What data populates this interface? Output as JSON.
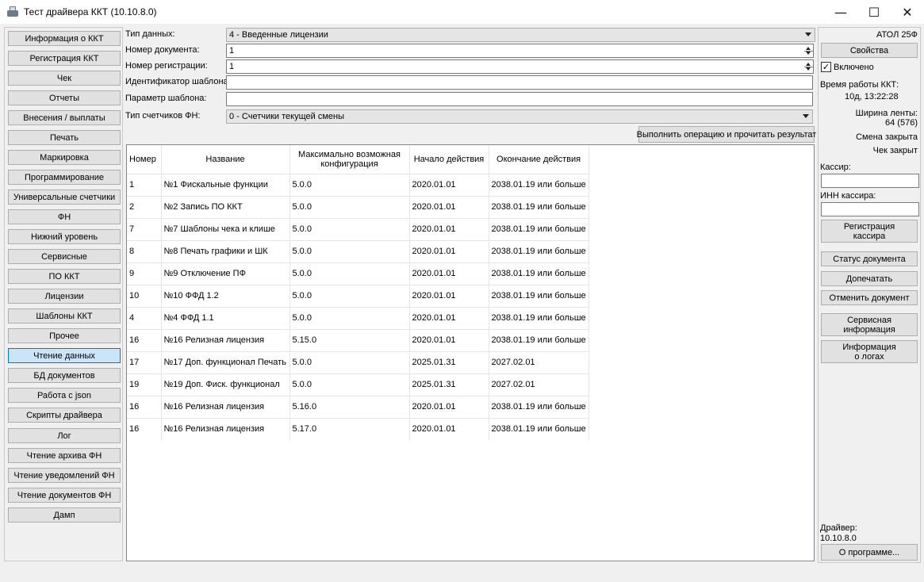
{
  "window": {
    "title": "Тест драйвера ККТ (10.10.8.0)",
    "min_glyph": "—",
    "max_glyph": "☐",
    "close_glyph": "✕"
  },
  "nav": [
    "Информация о ККТ",
    "Регистрация ККТ",
    "Чек",
    "Отчеты",
    "Внесения / выплаты",
    "Печать",
    "Маркировка",
    "Программирование",
    "Универсальные счетчики",
    "ФН",
    "Нижний уровень",
    "Сервисные",
    "ПО ККТ",
    "Лицензии",
    "Шаблоны ККТ",
    "Прочее",
    "Чтение данных",
    "БД документов",
    "Работа с json",
    "Скрипты драйвера",
    "Лог",
    "Чтение архива ФН",
    "Чтение уведомлений ФН",
    "Чтение документов ФН",
    "Дамп"
  ],
  "form": {
    "data_type_label": "Тип данных:",
    "data_type_value": "4 - Введенные лицензии",
    "doc_number_label": "Номер документа:",
    "doc_number_value": "1",
    "reg_number_label": "Номер регистрации:",
    "reg_number_value": "1",
    "template_id_label": "Идентификатор шаблона:",
    "template_id_value": "",
    "template_param_label": "Параметр шаблона:",
    "template_param_value": "",
    "fn_counter_label": "Тип счетчиков ФН:",
    "fn_counter_value": "0 - Счетчики текущей смены",
    "execute_label": "Выполнить операцию и прочитать результат"
  },
  "table": {
    "headers": [
      "Номер",
      "Название",
      "Максимально возможная конфигурация",
      "Начало действия",
      "Окончание действия"
    ],
    "rows": [
      [
        "1",
        "№1 Фискальные функции",
        "5.0.0",
        "2020.01.01",
        "2038.01.19 или больше"
      ],
      [
        "2",
        "№2 Запись ПО ККТ",
        "5.0.0",
        "2020.01.01",
        "2038.01.19 или больше"
      ],
      [
        "7",
        "№7 Шаблоны чека и клише",
        "5.0.0",
        "2020.01.01",
        "2038.01.19 или больше"
      ],
      [
        "8",
        "№8 Печать графики и ШК",
        "5.0.0",
        "2020.01.01",
        "2038.01.19 или больше"
      ],
      [
        "9",
        "№9 Отключение ПФ",
        "5.0.0",
        "2020.01.01",
        "2038.01.19 или больше"
      ],
      [
        "10",
        "№10 ФФД 1.2",
        "5.0.0",
        "2020.01.01",
        "2038.01.19 или больше"
      ],
      [
        "4",
        "№4 ФФД 1.1",
        "5.0.0",
        "2020.01.01",
        "2038.01.19 или больше"
      ],
      [
        "16",
        "№16 Релизная лицензия",
        "5.15.0",
        "2020.01.01",
        "2038.01.19 или больше"
      ],
      [
        "17",
        "№17 Доп. функционал Печать",
        "5.0.0",
        "2025.01.31",
        "2027.02.01"
      ],
      [
        "19",
        "№19 Доп. Фиск. функционал",
        "5.0.0",
        "2025.01.31",
        "2027.02.01"
      ],
      [
        "16",
        "№16 Релизная лицензия",
        "5.16.0",
        "2020.01.01",
        "2038.01.19 или больше"
      ],
      [
        "16",
        "№16 Релизная лицензия",
        "5.17.0",
        "2020.01.01",
        "2038.01.19 или больше"
      ]
    ]
  },
  "right": {
    "model": "АТОЛ 25Ф",
    "properties_label": "Свойства",
    "enabled_label": "Включено",
    "enabled_check": "✓",
    "uptime_label": "Время работы ККТ:",
    "uptime_value": "10д, 13:22:28",
    "tape_width_label": "Ширина ленты:",
    "tape_width_value": "64 (576)",
    "shift_status": "Смена закрыта",
    "receipt_status": "Чек закрыт",
    "cashier_label": "Кассир:",
    "cashier_inn_label": "ИНН кассира:",
    "register_cashier_line1": "Регистрация",
    "register_cashier_line2": "кассира",
    "doc_status_label": "Статус документа",
    "reprint_label": "Допечатать",
    "cancel_doc_label": "Отменить документ",
    "service_info_line1": "Сервисная",
    "service_info_line2": "информация",
    "logs_info_line1": "Информация",
    "logs_info_line2": "о логах",
    "driver_label": "Драйвер:",
    "driver_version": "10.10.8.0",
    "about_label": "О программе..."
  }
}
